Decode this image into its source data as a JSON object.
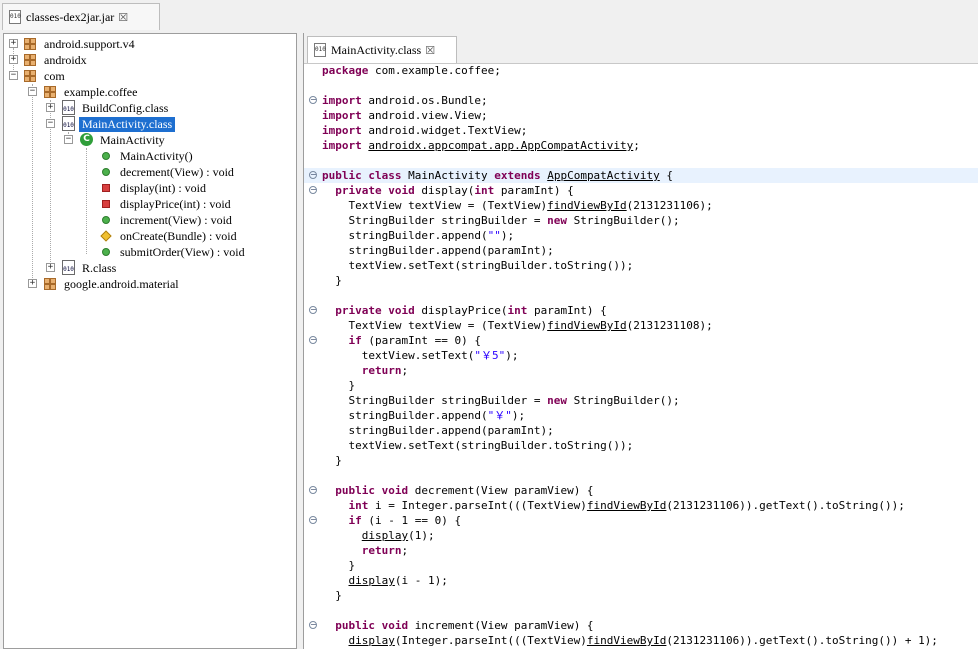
{
  "top_tab": {
    "label": "classes-dex2jar.jar",
    "icon": "jar-file-icon"
  },
  "tree": {
    "items": [
      {
        "label": "android.support.v4"
      },
      {
        "label": "androidx"
      },
      {
        "label": "com"
      },
      {
        "label": "example.coffee"
      },
      {
        "label": "BuildConfig.class"
      },
      {
        "label": "MainActivity.class"
      },
      {
        "label": "MainActivity"
      },
      {
        "label": "MainActivity()"
      },
      {
        "label": "decrement(View) : void"
      },
      {
        "label": "display(int) : void"
      },
      {
        "label": "displayPrice(int) : void"
      },
      {
        "label": "increment(View) : void"
      },
      {
        "label": "onCreate(Bundle) : void"
      },
      {
        "label": "submitOrder(View) : void"
      },
      {
        "label": "R.class"
      },
      {
        "label": "google.android.material"
      }
    ]
  },
  "editor": {
    "tab_label": "MainActivity.class",
    "lines": [
      "package com.example.coffee;",
      "",
      "import android.os.Bundle;",
      "import android.view.View;",
      "import android.widget.TextView;",
      "import androidx.appcompat.app.AppCompatActivity;",
      "",
      "public class MainActivity extends AppCompatActivity {",
      "  private void display(int paramInt) {",
      "    TextView textView = (TextView)findViewById(2131231106);",
      "    StringBuilder stringBuilder = new StringBuilder();",
      "    stringBuilder.append(\"\");",
      "    stringBuilder.append(paramInt);",
      "    textView.setText(stringBuilder.toString());",
      "  }",
      "",
      "  private void displayPrice(int paramInt) {",
      "    TextView textView = (TextView)findViewById(2131231108);",
      "    if (paramInt == 0) {",
      "      textView.setText(\"￥5\");",
      "      return;",
      "    }",
      "    StringBuilder stringBuilder = new StringBuilder();",
      "    stringBuilder.append(\"￥\");",
      "    stringBuilder.append(paramInt);",
      "    textView.setText(stringBuilder.toString());",
      "  }",
      "",
      "  public void decrement(View paramView) {",
      "    int i = Integer.parseInt(((TextView)findViewById(2131231106)).getText().toString());",
      "    if (i - 1 == 0) {",
      "      display(1);",
      "      return;",
      "    }",
      "    display(i - 1);",
      "  }",
      "",
      "  public void increment(View paramView) {",
      "    display(Integer.parseInt(((TextView)findViewById(2131231106)).getText().toString()) + 1);"
    ]
  }
}
